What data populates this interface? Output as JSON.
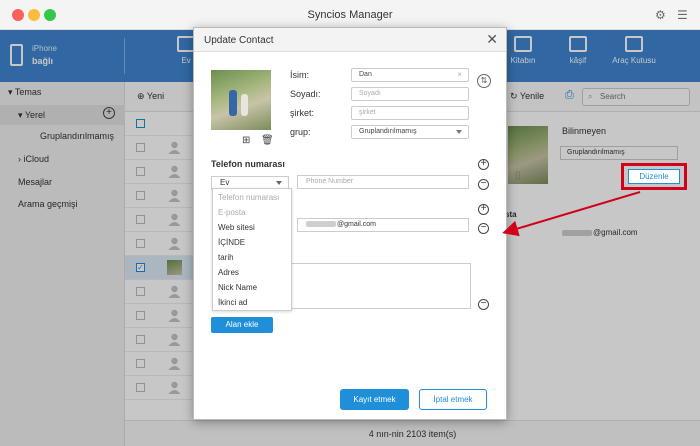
{
  "app": {
    "title": "Syncios Manager",
    "device_name": "iPhone",
    "device_status": "bağlı"
  },
  "nav": {
    "items": [
      {
        "label": "Ev",
        "icon": "home-icon"
      },
      {
        "label": "Kitabın",
        "icon": "book-icon"
      },
      {
        "label": "kâşif",
        "icon": "folder-icon"
      },
      {
        "label": "Araç Kutusu",
        "icon": "toolbox-icon"
      }
    ]
  },
  "sidebar": {
    "section_contacts": "Temas",
    "local": "Yerel",
    "ungrouped": "Gruplandırılmamış",
    "icloud": "iCloud",
    "messages": "Mesajlar",
    "call_history": "Arama geçmişi"
  },
  "toolbar": {
    "new_label": "Yeni",
    "refresh_label": "Yenile",
    "search_placeholder": "Search"
  },
  "detail": {
    "name": "Bilinmeyen",
    "group": "Gruplandırılmamış",
    "edit_label": "Düzenle",
    "email_section_fragment": "sta",
    "email_suffix": "@gmail.com"
  },
  "status": {
    "count_text": "4 nın-nin 2103 item(s)"
  },
  "dialog": {
    "title": "Update Contact",
    "first_name_label": "İsim:",
    "first_name_value": "Dan",
    "last_name_label": "Soyadı:",
    "last_name_placeholder": "Soyadı",
    "company_label": "şirket:",
    "company_placeholder": "şirket",
    "group_label": "grup:",
    "group_value": "Gruplandırılmamış",
    "phone_section_title": "Telefon numarası",
    "phone_type": "Ev",
    "phone_placeholder": "Phone Number",
    "email_value_suffix": "@gmail.com",
    "add_field_label": "Alan ekle",
    "save_label": "Kayıt etmek",
    "cancel_label": "İptal etmek",
    "field_type_options": [
      {
        "label": "Telefon numarası",
        "disabled": true
      },
      {
        "label": "E-posta",
        "disabled": true
      },
      {
        "label": "Web sitesi",
        "disabled": false
      },
      {
        "label": "İÇİNDE",
        "disabled": false
      },
      {
        "label": "tarih",
        "disabled": false
      },
      {
        "label": "Adres",
        "disabled": false
      },
      {
        "label": "Nick Name",
        "disabled": false
      },
      {
        "label": "İkinci ad",
        "disabled": false
      }
    ]
  },
  "colors": {
    "nav_blue": "#3f86d1",
    "accent_blue": "#1e8fd8",
    "annotation_red": "#d0021b"
  }
}
